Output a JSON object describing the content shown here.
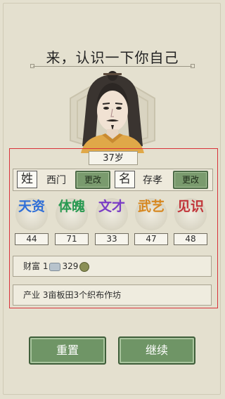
{
  "page": {
    "title": "来，认识一下你自己"
  },
  "profile": {
    "age": "37岁",
    "surname_label": "姓",
    "surname": "西门",
    "given_label": "名",
    "given_name": "存孝",
    "change_label": "更改"
  },
  "attributes": [
    {
      "glyph": "天资",
      "value": "44",
      "color": "#2f6fd8"
    },
    {
      "glyph": "体魄",
      "value": "71",
      "color": "#2a9a52"
    },
    {
      "glyph": "文才",
      "value": "33",
      "color": "#7a3cc6"
    },
    {
      "glyph": "武艺",
      "value": "47",
      "color": "#d7871f"
    },
    {
      "glyph": "见识",
      "value": "48",
      "color": "#c2353a"
    }
  ],
  "wealth": {
    "label": "财富",
    "silver": "1",
    "copper": "329"
  },
  "property": {
    "label": "产业",
    "value": "3亩板田3个织布作坊"
  },
  "buttons": {
    "reset": "重置",
    "continue": "继续"
  },
  "colors": {
    "accent_red": "#d8333a",
    "button_green": "#6f9566"
  }
}
